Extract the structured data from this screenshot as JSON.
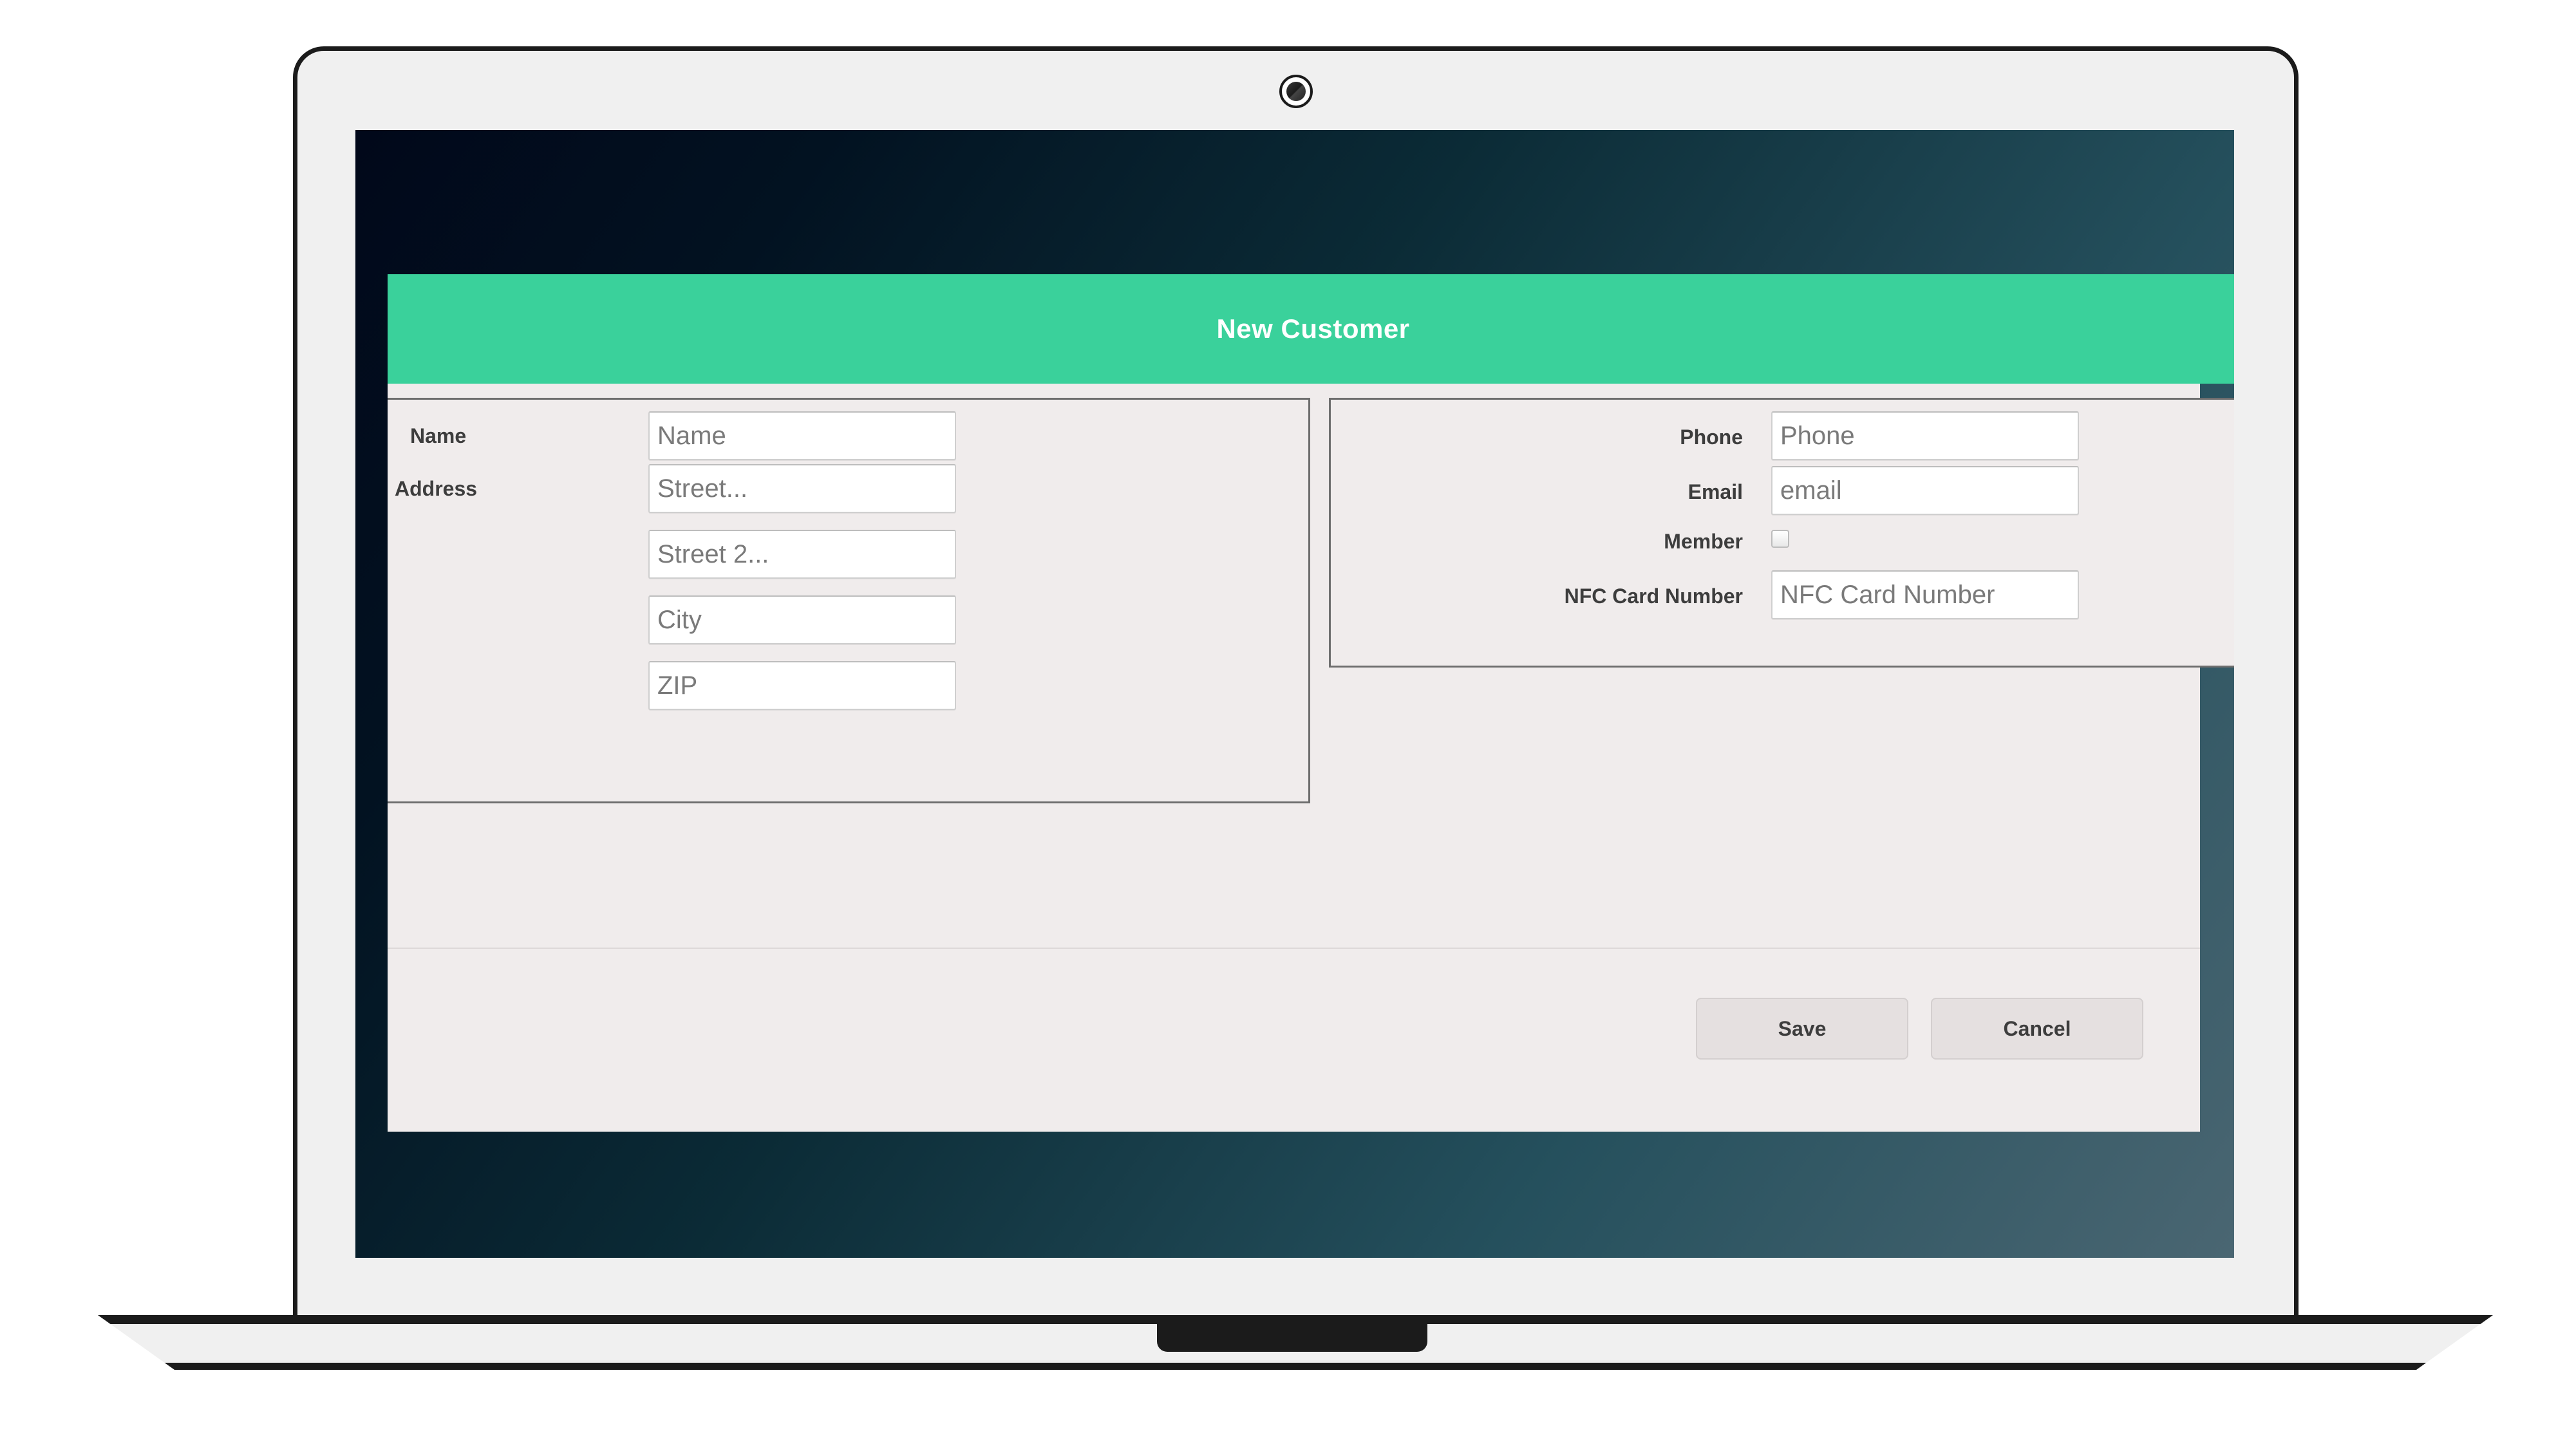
{
  "device": {
    "type": "laptop-mockup",
    "webcam_icon": "camera-icon"
  },
  "screen": {
    "background_gradient_from": "#01081a",
    "background_gradient_to": "#4a6672"
  },
  "dialog": {
    "title": "New Customer",
    "header_color": "#3ad19b",
    "body_color": "#f0ecec",
    "left_panel": {
      "labels": {
        "name": "Name",
        "address": "Address"
      },
      "fields": [
        {
          "name": "name",
          "placeholder": "Name",
          "value": ""
        },
        {
          "name": "street",
          "placeholder": "Street...",
          "value": ""
        },
        {
          "name": "street2",
          "placeholder": "Street 2...",
          "value": ""
        },
        {
          "name": "city",
          "placeholder": "City",
          "value": ""
        },
        {
          "name": "zip",
          "placeholder": "ZIP",
          "value": ""
        }
      ]
    },
    "right_panel": {
      "labels": {
        "phone": "Phone",
        "email": "Email",
        "member": "Member",
        "nfc": "NFC Card Number"
      },
      "fields": [
        {
          "name": "phone",
          "placeholder": "Phone",
          "value": ""
        },
        {
          "name": "email",
          "placeholder": "email",
          "value": ""
        },
        {
          "name": "nfc",
          "placeholder": "NFC Card Number",
          "value": ""
        }
      ],
      "member_checked": false
    },
    "footer": {
      "save_label": "Save",
      "cancel_label": "Cancel"
    }
  }
}
